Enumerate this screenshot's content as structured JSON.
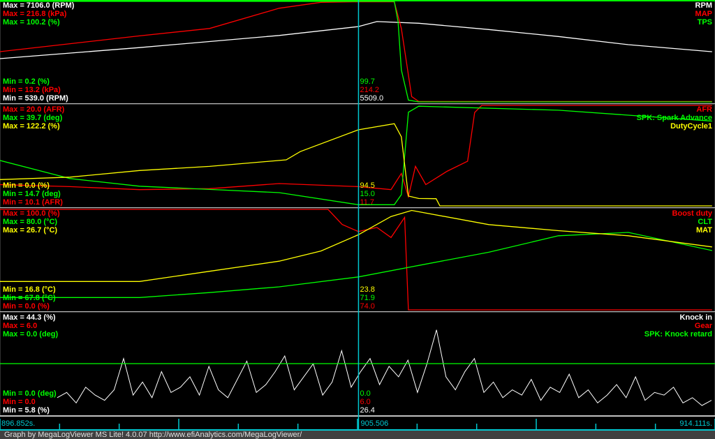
{
  "footer": "Graph by MegaLogViewer MS Lite! 4.0.07 http://www.efiAnalytics.com/MegaLogViewer/",
  "chart_data": {
    "type": "line",
    "xlim": [
      896.852,
      914.111
    ],
    "x_labels": {
      "start": "896.852s.",
      "cursor": "905.506",
      "end": "914.111s."
    },
    "cursor_time": 905.506,
    "colors": {
      "white": "#ffffff",
      "red": "#ff0000",
      "green": "#00ff00",
      "yellow": "#ffff00",
      "cursor": "#00c8d0",
      "divider": "#c0c0c0"
    },
    "panels": [
      {
        "series": [
          {
            "name": "RPM",
            "unit": "RPM",
            "color": "#ffffff",
            "max": "Max = 7106.0 (RPM)",
            "min": "Min = 539.0 (RPM)",
            "range": [
              539,
              7106
            ],
            "cursor_value": "5509.0",
            "points": [
              [
                896.85,
                3365
              ],
              [
                900.22,
                4085
              ],
              [
                903.59,
                4880
              ],
              [
                905.5,
                5460
              ],
              [
                905.95,
                5790
              ],
              [
                906.96,
                5680
              ],
              [
                908.65,
                5270
              ],
              [
                910.33,
                4810
              ],
              [
                912.02,
                4280
              ],
              [
                914.04,
                3820
              ]
            ]
          },
          {
            "name": "MAP",
            "unit": "kPa",
            "color": "#ff0000",
            "max": "Max = 216.8 (kPa)",
            "min": "Min = 13.2 (kPa)",
            "range": [
              13.2,
              216.8
            ],
            "cursor_value": "214.2",
            "points": [
              [
                896.85,
                115
              ],
              [
                900.22,
                147
              ],
              [
                901.91,
                162
              ],
              [
                903.59,
                203
              ],
              [
                904.6,
                215
              ],
              [
                905.5,
                216
              ],
              [
                906.37,
                216
              ],
              [
                906.54,
                162
              ],
              [
                906.79,
                24
              ],
              [
                906.96,
                14
              ],
              [
                914.04,
                14
              ]
            ]
          },
          {
            "name": "TPS",
            "unit": "%",
            "color": "#00ff00",
            "max": "Max = 100.2 (%)",
            "min": "Min = 0.2 (%)",
            "range": [
              0.2,
              100.2
            ],
            "cursor_value": "99.7",
            "points": [
              [
                896.85,
                100.2
              ],
              [
                906.37,
                100.2
              ],
              [
                906.46,
                80
              ],
              [
                906.54,
                32
              ],
              [
                906.71,
                2
              ],
              [
                906.96,
                0.2
              ],
              [
                914.04,
                0.2
              ]
            ]
          }
        ]
      },
      {
        "series": [
          {
            "name": "AFR",
            "unit": "AFR",
            "color": "#ff0000",
            "max": "Max = 20.0 (AFR)",
            "min": "Min = 10.1 (AFR)",
            "range": [
              10.1,
              20.0
            ],
            "cursor_value": "11.7",
            "points": [
              [
                896.85,
                12.2
              ],
              [
                898.54,
                12.0
              ],
              [
                900.22,
                11.7
              ],
              [
                901.91,
                11.8
              ],
              [
                903.59,
                12.3
              ],
              [
                905.5,
                12.0
              ],
              [
                906.29,
                11.7
              ],
              [
                906.54,
                13.3
              ],
              [
                906.71,
                11.0
              ],
              [
                906.88,
                14.0
              ],
              [
                907.13,
                12.2
              ],
              [
                907.64,
                13.5
              ],
              [
                908.14,
                14.5
              ],
              [
                908.31,
                19.3
              ],
              [
                908.48,
                20.0
              ],
              [
                914.04,
                20.0
              ]
            ]
          },
          {
            "name": "SPK: Spark Advance",
            "unit": "deg",
            "color": "#00ff00",
            "max": "Max = 39.7 (deg)",
            "min": "Min = 14.7 (deg)",
            "range": [
              14.7,
              39.7
            ],
            "cursor_value": "15.0",
            "points": [
              [
                896.85,
                26
              ],
              [
                898.54,
                21.5
              ],
              [
                900.22,
                19.6
              ],
              [
                901.91,
                18.8
              ],
              [
                903.59,
                18
              ],
              [
                905.5,
                15
              ],
              [
                906.37,
                15
              ],
              [
                906.54,
                17.5
              ],
              [
                906.71,
                38
              ],
              [
                906.96,
                39.5
              ],
              [
                910.33,
                38.5
              ],
              [
                914.04,
                35.8
              ]
            ]
          },
          {
            "name": "DutyCycle1",
            "unit": "%",
            "color": "#ffff00",
            "max": "Max = 122.2 (%)",
            "min": "Min = 0.0 (%)",
            "range": [
              0,
              122.2
            ],
            "cursor_value": "94.5",
            "points": [
              [
                896.85,
                32
              ],
              [
                898.54,
                35
              ],
              [
                900.22,
                43
              ],
              [
                901.91,
                48
              ],
              [
                903.76,
                56
              ],
              [
                904.1,
                66
              ],
              [
                905.5,
                92.5
              ],
              [
                906.37,
                100
              ],
              [
                906.54,
                84
              ],
              [
                906.71,
                12
              ],
              [
                906.96,
                9
              ],
              [
                907.38,
                8.7
              ],
              [
                907.47,
                0
              ],
              [
                914.04,
                0
              ]
            ]
          }
        ]
      },
      {
        "series": [
          {
            "name": "Boost duty",
            "unit": "%",
            "color": "#ff0000",
            "max": "Max = 100.0 (%)",
            "min": "Min = 0.0 (%)",
            "range": [
              0,
              100
            ],
            "cursor_value": "74.0",
            "points": [
              [
                896.85,
                100
              ],
              [
                904.77,
                100
              ],
              [
                905.11,
                85
              ],
              [
                905.5,
                78
              ],
              [
                905.95,
                82
              ],
              [
                906.29,
                72
              ],
              [
                906.62,
                92
              ],
              [
                906.71,
                0
              ],
              [
                914.04,
                0
              ]
            ]
          },
          {
            "name": "CLT",
            "unit": "°C",
            "color": "#00ff00",
            "max": "Max = 80.0 (°C)",
            "min": "Min = 67.8 (°C)",
            "range": [
              67.8,
              80.0
            ],
            "cursor_value": "71.9",
            "points": [
              [
                896.85,
                69.3
              ],
              [
                900.22,
                69.3
              ],
              [
                901.91,
                69.9
              ],
              [
                903.59,
                70.6
              ],
              [
                905.5,
                71.8
              ],
              [
                906.96,
                73.2
              ],
              [
                908.65,
                74.8
              ],
              [
                910.33,
                76.8
              ],
              [
                912.02,
                77.2
              ],
              [
                914.04,
                75
              ]
            ]
          },
          {
            "name": "MAT",
            "unit": "°C",
            "color": "#ffff00",
            "max": "Max = 26.7 (°C)",
            "min": "Min = 16.8 (°C)",
            "range": [
              16.8,
              26.7
            ],
            "cursor_value": "23.8",
            "points": [
              [
                896.85,
                19.6
              ],
              [
                900.22,
                19.6
              ],
              [
                901.91,
                20.6
              ],
              [
                903.59,
                21.6
              ],
              [
                904.6,
                22.6
              ],
              [
                905.5,
                24.2
              ],
              [
                906.29,
                26.0
              ],
              [
                906.79,
                26.6
              ],
              [
                908.65,
                25.2
              ],
              [
                910.33,
                24.6
              ],
              [
                912.02,
                24.1
              ],
              [
                914.04,
                23
              ]
            ]
          }
        ]
      },
      {
        "series": [
          {
            "name": "Knock in",
            "unit": "%",
            "color": "#ffffff",
            "max": "Max = 44.3 (%)",
            "min": "Min = 5.8 (%)",
            "range": [
              5.8,
              44.3
            ],
            "cursor_value": "26.4",
            "values": [
              12,
              14,
              10,
              16,
              13,
              11,
              15,
              27,
              13,
              18,
              12,
              22,
              14,
              16,
              20,
              13,
              24,
              15,
              12,
              19,
              26,
              14,
              17,
              22,
              28,
              15,
              20,
              25,
              13,
              18,
              30,
              16,
              22,
              27,
              17,
              24,
              20,
              26.4,
              14,
              25,
              38,
              20,
              15,
              22,
              27,
              14,
              18,
              12,
              15,
              13,
              19,
              11,
              16,
              14,
              21,
              12,
              15,
              10,
              13,
              17,
              12,
              20,
              11,
              14,
              13,
              16,
              10,
              12,
              9,
              11
            ]
          },
          {
            "name": "Gear",
            "unit": "",
            "color": "#ff0000",
            "max": "Max = 6.0",
            "min": "Min = 0.0",
            "range": [
              0,
              6
            ],
            "cursor_value": "6.0",
            "points": []
          },
          {
            "name": "SPK: Knock retard",
            "unit": "deg",
            "color": "#00ff00",
            "max": "Max = 0.0 (deg)",
            "min": "Min = 0.0 (deg)",
            "range": [
              -1,
              1
            ],
            "cursor_value": "0.0",
            "points": [
              [
                896.852,
                0
              ],
              [
                914.111,
                0
              ]
            ]
          }
        ]
      }
    ]
  }
}
